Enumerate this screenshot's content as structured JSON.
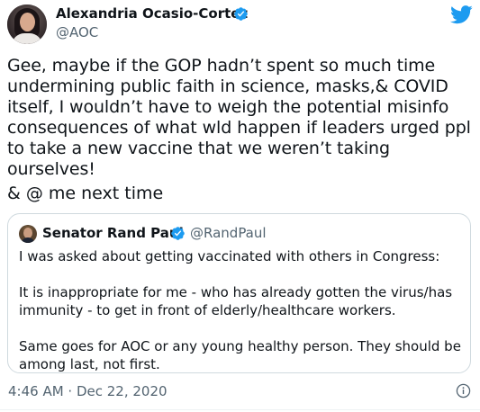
{
  "author": {
    "name": "Alexandria Ocasio-Cortez",
    "handle": "@AOC",
    "verified": true
  },
  "tweet": {
    "text": "Gee, maybe if the GOP hadn’t spent so much time\nundermining public faith in science, masks,& COVID\nitself, I wouldn’t have to weigh the potential misinfo\nconsequences of what wld happen if leaders urged ppl\nto take a new vaccine that we weren’t taking ourselves!",
    "text_2": "& @ me next time"
  },
  "quoted_tweet": {
    "name": "Senator Rand Paul",
    "handle": "@RandPaul",
    "verified": true,
    "text": "I was asked about getting vaccinated with others in Congress:\n\nIt is inappropriate for me - who has already gotten the virus/has\nimmunity - to get in front of elderly/healthcare workers.\n\nSame goes for AOC or any young healthy person. They should be\namong last, not first."
  },
  "meta": {
    "timestamp": "4:46 AM · Dec 22, 2020"
  },
  "icons": {
    "verified": "verified-badge-icon",
    "brand": "twitter-bird-icon",
    "info": "info-icon"
  },
  "colors": {
    "brand_blue": "#1d9bf0",
    "secondary_text": "#536471",
    "border": "#cfd9de"
  }
}
